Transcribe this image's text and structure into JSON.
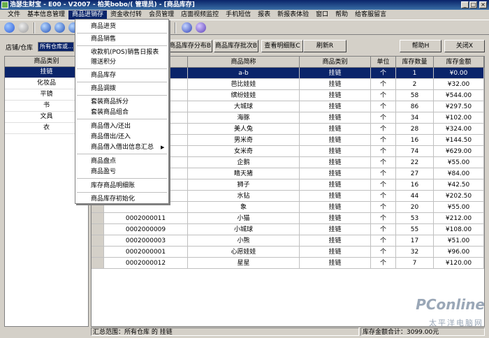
{
  "window": {
    "title": "浩瑟生财宝 - E00 - V2007 - 柏芙bobo/( 管理员) - [商品库存]",
    "controls": [
      "_",
      "□",
      "×"
    ]
  },
  "menubar": {
    "items": [
      "文件",
      "基本信息管理",
      "商品进销存",
      "资金收付转",
      "会员管理",
      "店面视频监控",
      "手机短信",
      "报表",
      "新报表体验",
      "窗口",
      "帮助",
      "给客服留言"
    ],
    "active_index": 2
  },
  "toolbar": {
    "icons": [
      "back-icon",
      "forward-icon",
      "globe-icon",
      "refresh-icon",
      "home-icon",
      "help-icon",
      "info-icon"
    ]
  },
  "filter": {
    "store_label": "店铺/仓库",
    "store_value": "所有仓库或...",
    "buttons": {
      "stock_distribution": "商品库存分布B",
      "stock_batch": "商品库存批次B",
      "view_detail": "查看明细账C",
      "refresh": "刷新R",
      "help": "帮助H",
      "close": "关闭X"
    }
  },
  "category_list": {
    "header": "商品类别",
    "items": [
      "挂链",
      "化妆品",
      "平镜",
      "书",
      "文具",
      "衣"
    ],
    "selected_index": 0
  },
  "dropdown": {
    "items": [
      "商品进货",
      "商品销售",
      "收款机(POS)销售日报表",
      "赠送积分",
      "商品库存",
      "商品调拨",
      "套装商品拆分",
      "套装商品组合",
      "商品借入/还出",
      "商品借出/还入",
      "商品借入借出信息汇总",
      "商品盘点",
      "商品盈亏",
      "库存商品明细账",
      "商品库存初始化"
    ]
  },
  "grid": {
    "columns": [
      "",
      "",
      "商品简称",
      "商品类别",
      "单位",
      "库存数量",
      "库存金额"
    ],
    "rows": [
      {
        "code": "",
        "name": "a-b",
        "category": "挂链",
        "unit": "个",
        "qty": "1",
        "amount": "¥0.00"
      },
      {
        "code": "",
        "name": "芭比娃娃",
        "category": "挂链",
        "unit": "个",
        "qty": "2",
        "amount": "¥32.00"
      },
      {
        "code": "",
        "name": "缤纷娃娃",
        "category": "挂链",
        "unit": "个",
        "qty": "58",
        "amount": "¥544.00"
      },
      {
        "code": "",
        "name": "大城球",
        "category": "挂链",
        "unit": "个",
        "qty": "86",
        "amount": "¥297.50"
      },
      {
        "code": "",
        "name": "海豚",
        "category": "挂链",
        "unit": "个",
        "qty": "34",
        "amount": "¥102.00"
      },
      {
        "code": "",
        "name": "美人兔",
        "category": "挂链",
        "unit": "个",
        "qty": "28",
        "amount": "¥324.00"
      },
      {
        "code": "",
        "name": "男米奇",
        "category": "挂链",
        "unit": "个",
        "qty": "16",
        "amount": "¥144.50"
      },
      {
        "code": "",
        "name": "女米奇",
        "category": "挂链",
        "unit": "个",
        "qty": "74",
        "amount": "¥629.00"
      },
      {
        "code": "",
        "name": "企鹅",
        "category": "挂链",
        "unit": "个",
        "qty": "22",
        "amount": "¥55.00"
      },
      {
        "code": "",
        "name": "睛天猪",
        "category": "挂链",
        "unit": "个",
        "qty": "27",
        "amount": "¥84.00"
      },
      {
        "code": "",
        "name": "狮子",
        "category": "挂链",
        "unit": "个",
        "qty": "16",
        "amount": "¥42.50"
      },
      {
        "code": "",
        "name": "水钻",
        "category": "挂链",
        "unit": "个",
        "qty": "44",
        "amount": "¥202.50"
      },
      {
        "code": "",
        "name": "象",
        "category": "挂链",
        "unit": "个",
        "qty": "20",
        "amount": "¥55.00"
      },
      {
        "code": "0002000011",
        "name": "小猫",
        "category": "挂链",
        "unit": "个",
        "qty": "53",
        "amount": "¥212.00"
      },
      {
        "code": "0002000009",
        "name": "小城球",
        "category": "挂链",
        "unit": "个",
        "qty": "55",
        "amount": "¥108.00"
      },
      {
        "code": "0002000003",
        "name": "小熊",
        "category": "挂链",
        "unit": "个",
        "qty": "17",
        "amount": "¥51.00"
      },
      {
        "code": "0002000001",
        "name": "心愿娃娃",
        "category": "挂链",
        "unit": "个",
        "qty": "32",
        "amount": "¥96.00"
      },
      {
        "code": "0002000012",
        "name": "星星",
        "category": "挂链",
        "unit": "个",
        "qty": "7",
        "amount": "¥120.00"
      }
    ],
    "selected_index": 0
  },
  "status": {
    "left": "汇总范围：所有仓库 的 挂链",
    "right": "库存金额合计：3099.00元"
  },
  "watermark": {
    "brand": "PConline",
    "sub": "太平洋电脑网"
  },
  "colors": {
    "selection": "#0a246a",
    "chrome": "#d4d0c8"
  }
}
